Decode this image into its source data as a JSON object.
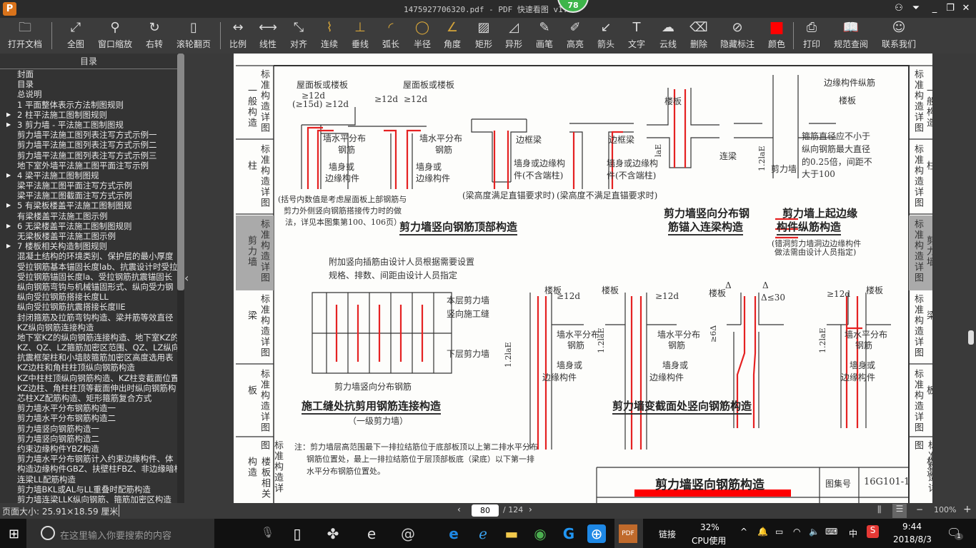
{
  "window": {
    "title": "1475927706320.pdf - PDF 快速看图 v1.9",
    "logo": "P",
    "badge": "78",
    "controls": [
      "user-icon",
      "menu-icon",
      "minimize-icon",
      "restore-icon",
      "close-icon"
    ]
  },
  "toolbar": {
    "items": [
      {
        "label": "打开文档",
        "icon": "folder-icon"
      },
      {
        "label": "全图",
        "icon": "fit-icon"
      },
      {
        "label": "窗口缩放",
        "icon": "zoom-icon"
      },
      {
        "label": "右转",
        "icon": "rotate-icon"
      },
      {
        "label": "滚轮翻页",
        "icon": "mouse-icon"
      },
      {
        "label": "比例",
        "icon": "scale-icon"
      },
      {
        "label": "线性",
        "icon": "linear-icon"
      },
      {
        "label": "对齐",
        "icon": "aligned-icon"
      },
      {
        "label": "连续",
        "icon": "continuous-icon"
      },
      {
        "label": "垂线",
        "icon": "perpendicular-icon"
      },
      {
        "label": "弧长",
        "icon": "arc-icon"
      },
      {
        "label": "半径",
        "icon": "radius-icon"
      },
      {
        "label": "角度",
        "icon": "angle-icon"
      },
      {
        "label": "矩形",
        "icon": "rectangle-icon"
      },
      {
        "label": "异形",
        "icon": "polygon-icon"
      },
      {
        "label": "画笔",
        "icon": "pen-icon"
      },
      {
        "label": "高亮",
        "icon": "highlighter-icon"
      },
      {
        "label": "箭头",
        "icon": "arrow-icon"
      },
      {
        "label": "文字",
        "icon": "text-icon"
      },
      {
        "label": "云线",
        "icon": "cloud-icon"
      },
      {
        "label": "删除",
        "icon": "eraser-icon"
      },
      {
        "label": "隐藏标注",
        "icon": "hide-icon"
      },
      {
        "label": "颜色",
        "icon": "color-icon"
      },
      {
        "label": "打印",
        "icon": "print-icon"
      },
      {
        "label": "规范查阅",
        "icon": "book-icon"
      },
      {
        "label": "联系我们",
        "icon": "qq-icon"
      }
    ],
    "color": "#ff0000"
  },
  "sidebar": {
    "title": "目录",
    "items": [
      {
        "label": "封面",
        "expand": false
      },
      {
        "label": "目录",
        "expand": false
      },
      {
        "label": "总说明",
        "expand": false
      },
      {
        "label": "1 平面整体表示方法制图规则",
        "expand": false
      },
      {
        "label": "2 柱平法施工图制图规则",
        "expand": true
      },
      {
        "label": "3 剪力墙 - 平法施工图制图规",
        "expand": true
      },
      {
        "label": "剪力墙平法施工图列表注写方式示例一",
        "expand": false
      },
      {
        "label": "剪力墙平法施工图列表注写方式示例二",
        "expand": false
      },
      {
        "label": "剪力墙平法施工图列表注写方式示例三",
        "expand": false
      },
      {
        "label": "地下室外墙平法施工图平面注写示例",
        "expand": false
      },
      {
        "label": "4 梁平法施工图制图规",
        "expand": true
      },
      {
        "label": "梁平法施工图平面注写方式示例",
        "expand": false
      },
      {
        "label": "梁平法施工图截面注写方式示例",
        "expand": false
      },
      {
        "label": "5 有梁板楼盖平法施工图制图规",
        "expand": true
      },
      {
        "label": "有梁楼盖平法施工图示例",
        "expand": false
      },
      {
        "label": "6 无梁楼盖平法施工图制图规则",
        "expand": true
      },
      {
        "label": "无梁板楼盖平法施工图示例",
        "expand": false
      },
      {
        "label": "7 楼板相关构造制图规则",
        "expand": true
      },
      {
        "label": "混凝土结构的环境类别、保护层的最小厚度",
        "expand": false
      },
      {
        "label": "受拉钢筋基本锚固长度lab、抗震设计时受拉",
        "expand": false
      },
      {
        "label": "受拉钢筋锚固长度la、受拉钢筋抗震锚固长",
        "expand": false
      },
      {
        "label": "纵向钢筋弯钩与机械锚固形式、纵向受力钢",
        "expand": false
      },
      {
        "label": "纵向受拉钢筋搭接长度LL",
        "expand": false
      },
      {
        "label": "纵向受拉钢筋抗震搭接长度llE",
        "expand": false
      },
      {
        "label": "封闭箍筋及拉筋弯钩构造、梁并筋等效直径",
        "expand": false
      },
      {
        "label": "KZ纵向钢筋连接构造",
        "expand": false
      },
      {
        "label": "地下室KZ的纵向钢筋连接构造、地下室KZ的",
        "expand": false
      },
      {
        "label": "KZ、QZ、LZ箍筋加密区范围、QZ、LZ纵向钢",
        "expand": false
      },
      {
        "label": "抗震框架柱和小墙肢箍筋加密区高度选用表",
        "expand": false
      },
      {
        "label": "KZ边柱和角柱柱顶纵向钢筋构造",
        "expand": false
      },
      {
        "label": "KZ中柱柱顶纵向钢筋构造、KZ柱变截面位置",
        "expand": false
      },
      {
        "label": "KZ边柱、角柱柱顶等截面伸出时纵向钢筋构",
        "expand": false
      },
      {
        "label": "芯柱XZ配筋构造、矩形箍筋复合方式",
        "expand": false
      },
      {
        "label": "剪力墙水平分布钢筋构造一",
        "expand": false
      },
      {
        "label": "剪力墙水平分布钢筋构造二",
        "expand": false
      },
      {
        "label": "剪力墙竖向钢筋构造一",
        "expand": false
      },
      {
        "label": "剪力墙竖向钢筋构造二",
        "expand": false
      },
      {
        "label": "约束边缘构件YBZ构造",
        "expand": false
      },
      {
        "label": "剪力墙水平分布钢筋计入约束边缘构件、体",
        "expand": false
      },
      {
        "label": "构造边缘构件GBZ、扶壁柱FBZ、非边缘暗柱",
        "expand": false
      },
      {
        "label": "连梁LL配筋构造",
        "expand": false
      },
      {
        "label": "剪力墙BKL或AL与LL重叠时配筋构造",
        "expand": false
      },
      {
        "label": "剪力墙连梁LLK纵向钢筋、箍筋加密区构造",
        "expand": false
      }
    ]
  },
  "document": {
    "left_tabs": [
      {
        "name": "一般构造",
        "sub": "标准构造详图"
      },
      {
        "name": "柱",
        "sub": "标准构造详图"
      },
      {
        "name": "剪力墙",
        "sub": "标准构造详图",
        "active": true
      },
      {
        "name": "梁",
        "sub": "标准构造详图"
      },
      {
        "name": "板",
        "sub": "标准构造详图"
      },
      {
        "name": "楼板相关构造",
        "sub": "标准构造详图"
      }
    ],
    "right_tabs": [
      {
        "name": "一般构造",
        "sub": "标准构造详图"
      },
      {
        "name": "柱",
        "sub": "标准构造详图"
      },
      {
        "name": "剪力墙",
        "sub": "标准构造详图",
        "active": true
      },
      {
        "name": "梁",
        "sub": "标准构造详图"
      },
      {
        "name": "板",
        "sub": "标准构造详图"
      },
      {
        "name": "楼板相关构造",
        "sub": "标准构造详图"
      }
    ],
    "labels": {
      "roof_slab": "屋面板或楼板",
      "ge12d": "≥12d",
      "ge15d": "(≥15d)",
      "horiz_bar": "墙水平分布",
      "bar": "钢筋",
      "wall_or": "墙身或",
      "edge_member": "边缘构件",
      "note_bracket": "(括号内数值是考虑屋面板上部钢筋与",
      "note_bracket2": "剪力外侧竖向钢筋搭接传力时的做",
      "note_bracket3": "法，详见本图集第100、106页）",
      "edge_beam": "边框梁",
      "wall_edge": "墙身或边缘构",
      "no_end_col": "件(不含端柱)",
      "beam_ok": "(梁高度满足直锚要求时)",
      "beam_not_ok": "(梁高度不满足直锚要求时)",
      "slab": "楼板",
      "laE": "laE",
      "coupling_beam": "连梁",
      "edge_long_bar": "边缘构件纵筋",
      "stirrup_note1": "箍筋直径应不小于",
      "stirrup_note2": "纵向钢筋最大直径",
      "stirrup_note3": "的0.25倍，间距不",
      "stirrup_note4": "大于100",
      "shear_wall": "剪力墙",
      "onetwo_laE": "1.2laE",
      "add_bar1": "附加竖向插筋由设计人员根据需要设置",
      "add_bar2": "规格、排数、间距由设计人员指定",
      "this_floor": "本层剪力墙",
      "const_joint": "竖向施工缝",
      "lower_floor": "下层剪力墙",
      "vert_bar": "剪力墙竖向分布钢筋",
      "delta": "Δ",
      "delta30": "Δ≤30",
      "ge6d": "≥6Δ",
      "sub_grade1": "（一级剪力墙）",
      "hole_note1": "(错洞剪力墙洞边边缘构件",
      "hole_note2": "做法需由设计人员指定)",
      "note1": "注：剪力墙层高范围最下一排拉结筋位于底部板顶以上第二排水平分布",
      "note2": "钢筋位置处，最上一排拉结筋位于层顶部板底（梁底）以下第一排",
      "note3": "水平分布钢筋位置处。"
    },
    "headings": {
      "top": "剪力墙竖向钢筋顶部构造",
      "anchor": "剪力墙竖向分布钢筋锚入连梁构造",
      "anchor_l1": "剪力墙竖向分布钢",
      "anchor_l2": "筋锚入连梁构造",
      "edge_l1": "剪力墙上起边缘",
      "edge_l2": "构件纵筋构造",
      "joint": "施工缝处抗剪用钢筋连接构造",
      "section": "剪力墙变截面处竖向钢筋构造"
    },
    "title_block": {
      "title": "剪力墙竖向钢筋构造",
      "atlas_label": "图集号",
      "atlas_no": "16G101-1"
    }
  },
  "status": {
    "page_size": "页面大小: 25.91×18.59 厘米",
    "current_page": "80",
    "total_pages": "/ 124",
    "zoom": "100%",
    "minus": "−",
    "plus": "+"
  },
  "taskbar": {
    "search_placeholder": "在这里输入你要搜索的内容",
    "link_label": "链接",
    "cpu_percent": "32%",
    "cpu_label": "CPU使用",
    "ime": "中",
    "time": "9:44",
    "date": "2018/8/3",
    "notifications": "1"
  }
}
